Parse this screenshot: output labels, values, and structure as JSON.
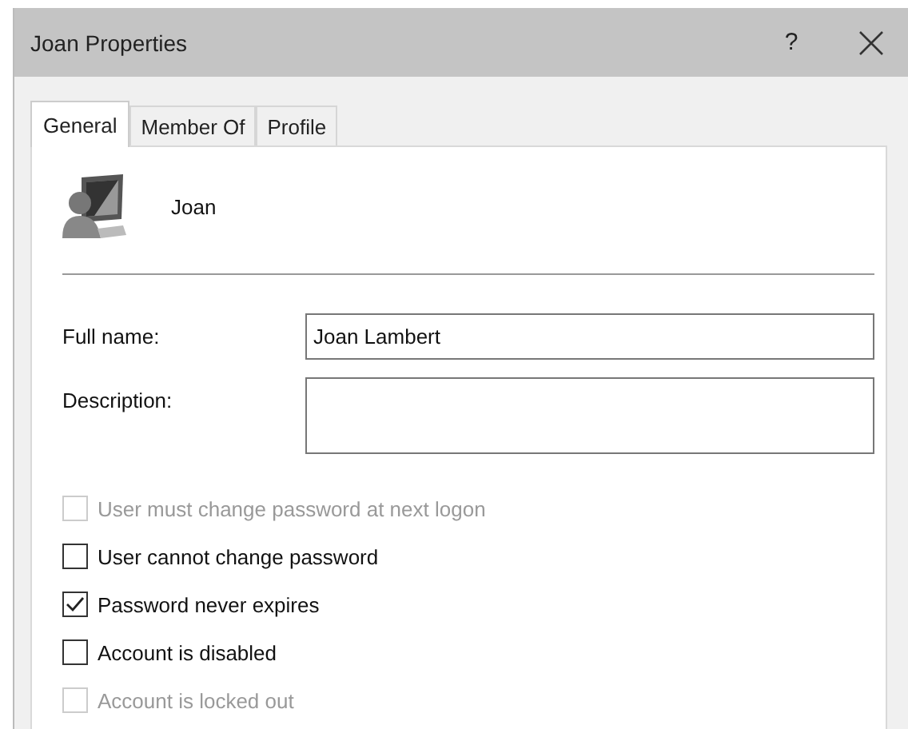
{
  "window": {
    "title": "Joan Properties",
    "help_button": "?"
  },
  "tabs": [
    {
      "label": "General",
      "selected": true
    },
    {
      "label": "Member Of",
      "selected": false
    },
    {
      "label": "Profile",
      "selected": false
    }
  ],
  "user": {
    "name": "Joan"
  },
  "fields": [
    {
      "label": "Full name:",
      "value": "Joan Lambert",
      "kind": "line"
    },
    {
      "label": "Description:",
      "kind": "box"
    }
  ],
  "options": [
    {
      "label": "User must change password at next logon",
      "checked": false,
      "disabled": true
    },
    {
      "label": "User cannot change password",
      "checked": false,
      "disabled": false
    },
    {
      "label": "Password never expires",
      "checked": true,
      "disabled": false
    },
    {
      "label": "Account is disabled",
      "checked": false,
      "disabled": false
    },
    {
      "label": "Account is locked out",
      "checked": false,
      "disabled": true
    }
  ]
}
